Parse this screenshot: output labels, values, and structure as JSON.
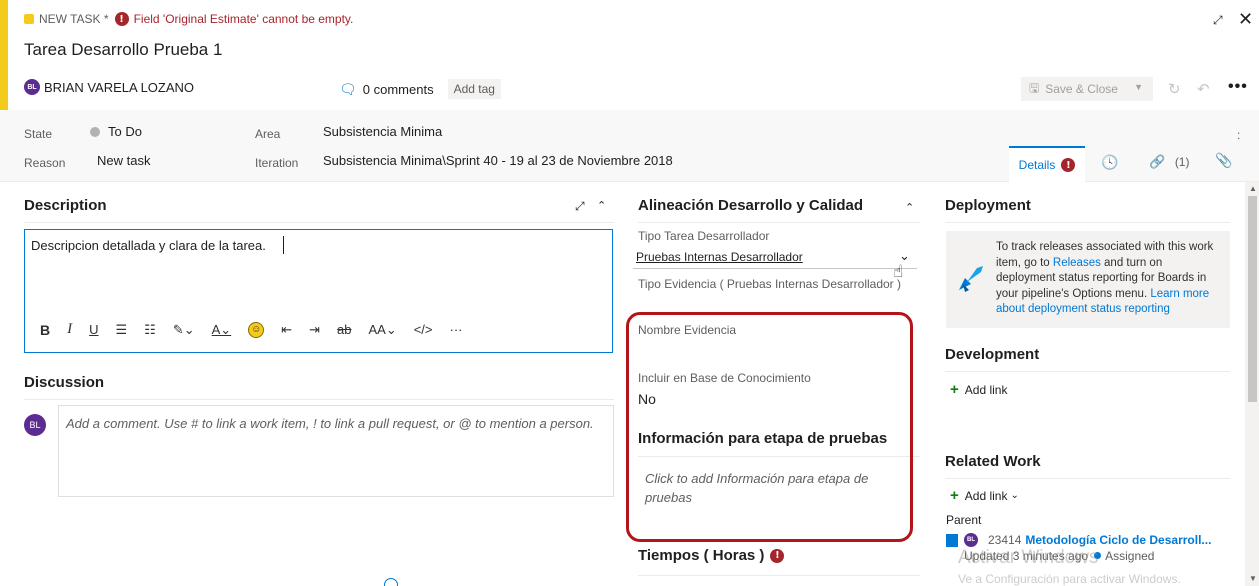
{
  "header": {
    "work_item_type": "NEW TASK *",
    "error_message": "Field 'Original Estimate' cannot be empty.",
    "error_glyph": "!",
    "title": "Tarea Desarrollo Prueba 1",
    "assignee": {
      "initials": "BL",
      "name": "BRIAN VARELA LOZANO"
    },
    "comments_label": "0 comments",
    "add_tag_label": "Add tag",
    "save_close_label": "Save & Close",
    "more_label": "•••"
  },
  "fields": {
    "state": {
      "label": "State",
      "value": "To Do"
    },
    "reason": {
      "label": "Reason",
      "value": "New task"
    },
    "area": {
      "label": "Area",
      "value": "Subsistencia Minima"
    },
    "iteration": {
      "label": "Iteration",
      "value": "Subsistencia Minima\\Sprint 40 - 19 al 23 de Noviembre 2018"
    }
  },
  "tabs": {
    "details": "Details",
    "links": "(1)"
  },
  "description": {
    "title": "Description",
    "text": "Descripcion detallada y clara de la tarea.",
    "toolbar_more": "···"
  },
  "discussion": {
    "title": "Discussion",
    "avatar_initials": "BL",
    "placeholder": "Add a comment. Use # to link a work item, ! to link a pull request, or @ to mention a person."
  },
  "alineacion": {
    "title": "Alineación Desarrollo y Calidad",
    "tipo_tarea_label": "Tipo Tarea Desarrollador",
    "tipo_tarea_value": "Pruebas Internas Desarrollador",
    "tipo_evidencia_label": "Tipo Evidencia ( Pruebas Internas Desarrollador )",
    "nombre_evidencia_label": "Nombre Evidencia",
    "incluir_label": "Incluir en Base de Conocimiento",
    "incluir_value": "No"
  },
  "info_pruebas": {
    "title": "Información para etapa de pruebas",
    "placeholder": "Click to add Información para etapa de pruebas"
  },
  "tiempos": {
    "title": "Tiempos ( Horas )"
  },
  "deployment": {
    "title": "Deployment",
    "msg_part1": "To track releases associated with this work item, go to ",
    "msg_link1": "Releases",
    "msg_part2": " and turn on deployment status reporting for Boards in your pipeline's Options menu. ",
    "msg_link2": "Learn more about deployment status reporting"
  },
  "development": {
    "title": "Development",
    "add_link": "Add link"
  },
  "related_work": {
    "title": "Related Work",
    "add_link": "Add link",
    "parent_label": "Parent",
    "parent": {
      "avatar_initials": "BL",
      "id": "23414",
      "title": "Metodología Ciclo de Desarroll...",
      "updated": "Updated 3 minutes ago",
      "state": "Assigned"
    }
  },
  "watermark": {
    "line1": "Activar Windows",
    "line2": "Ve a Configuración para activar Windows."
  },
  "colors": {
    "accent": "#f2cb1d",
    "error": "#a4262c",
    "link": "#0078d4",
    "highlight": "#b3141a"
  }
}
